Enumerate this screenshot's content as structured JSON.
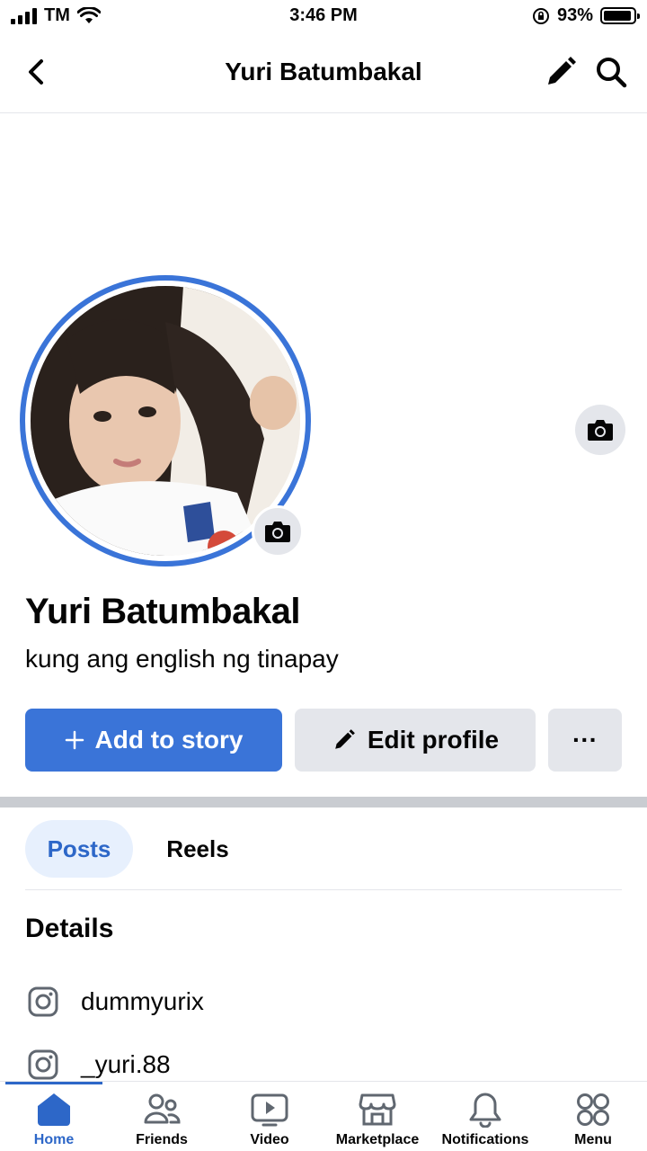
{
  "status_bar": {
    "carrier": "TM",
    "time": "3:46 PM",
    "battery_percent": "93%",
    "battery_level": 0.93
  },
  "header": {
    "title": "Yuri Batumbakal",
    "icons": [
      "back-arrow-icon",
      "pencil-icon",
      "search-icon"
    ]
  },
  "profile": {
    "name": "Yuri Batumbakal",
    "bio": "kung ang english ng tinapay"
  },
  "actions": {
    "add_to_story": "Add to story",
    "edit_profile": "Edit profile",
    "more": "···"
  },
  "tabs": [
    {
      "label": "Posts",
      "active": true
    },
    {
      "label": "Reels",
      "active": false
    }
  ],
  "details": {
    "title": "Details",
    "items": [
      {
        "icon": "instagram-icon",
        "label": "dummyurix"
      },
      {
        "icon": "instagram-icon",
        "label": "_yuri.88"
      }
    ]
  },
  "bottom_nav": [
    {
      "label": "Home",
      "icon": "home-icon",
      "active": true
    },
    {
      "label": "Friends",
      "icon": "friends-icon",
      "active": false
    },
    {
      "label": "Video",
      "icon": "video-icon",
      "active": false
    },
    {
      "label": "Marketplace",
      "icon": "marketplace-icon",
      "active": false
    },
    {
      "label": "Notifications",
      "icon": "bell-icon",
      "active": false
    },
    {
      "label": "Menu",
      "icon": "menu-grid-icon",
      "active": false
    }
  ],
  "colors": {
    "accent": "#3a74d8",
    "button_gray": "#e4e6eb",
    "tab_active_bg": "#e7f0fd"
  }
}
